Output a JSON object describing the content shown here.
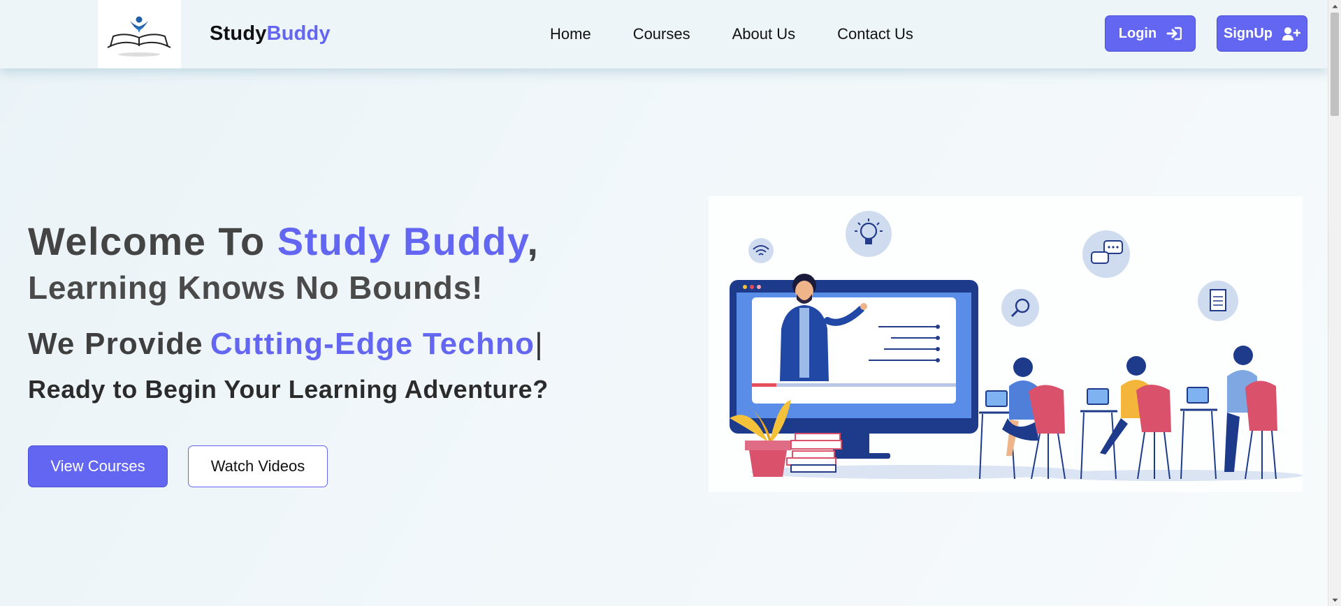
{
  "header": {
    "brand_part1": "Study",
    "brand_part2": "Buddy",
    "nav": [
      "Home",
      "Courses",
      "About Us",
      "Contact Us"
    ],
    "login_label": "Login",
    "signup_label": "SignUp"
  },
  "hero": {
    "welcome": "Welcome To ",
    "brand_name": "Study Buddy",
    "comma": ",",
    "tagline": "Learning Knows No Bounds!",
    "provide_prefix": "We Provide",
    "provide_typed": "Cutting-Edge Techno",
    "cursor": "|",
    "question": "Ready to Begin Your Learning Adventure?",
    "view_courses_label": "View Courses",
    "watch_videos_label": "Watch Videos"
  },
  "colors": {
    "accent": "#6366f1",
    "heading": "#444444",
    "header_bg": "#eef5f8"
  },
  "icons": [
    "open-book-logo-icon",
    "login-arrow-icon",
    "user-plus-icon",
    "wifi-icon",
    "lightbulb-icon",
    "chat-bubbles-icon",
    "magnifier-icon",
    "document-icon",
    "play-icon"
  ]
}
